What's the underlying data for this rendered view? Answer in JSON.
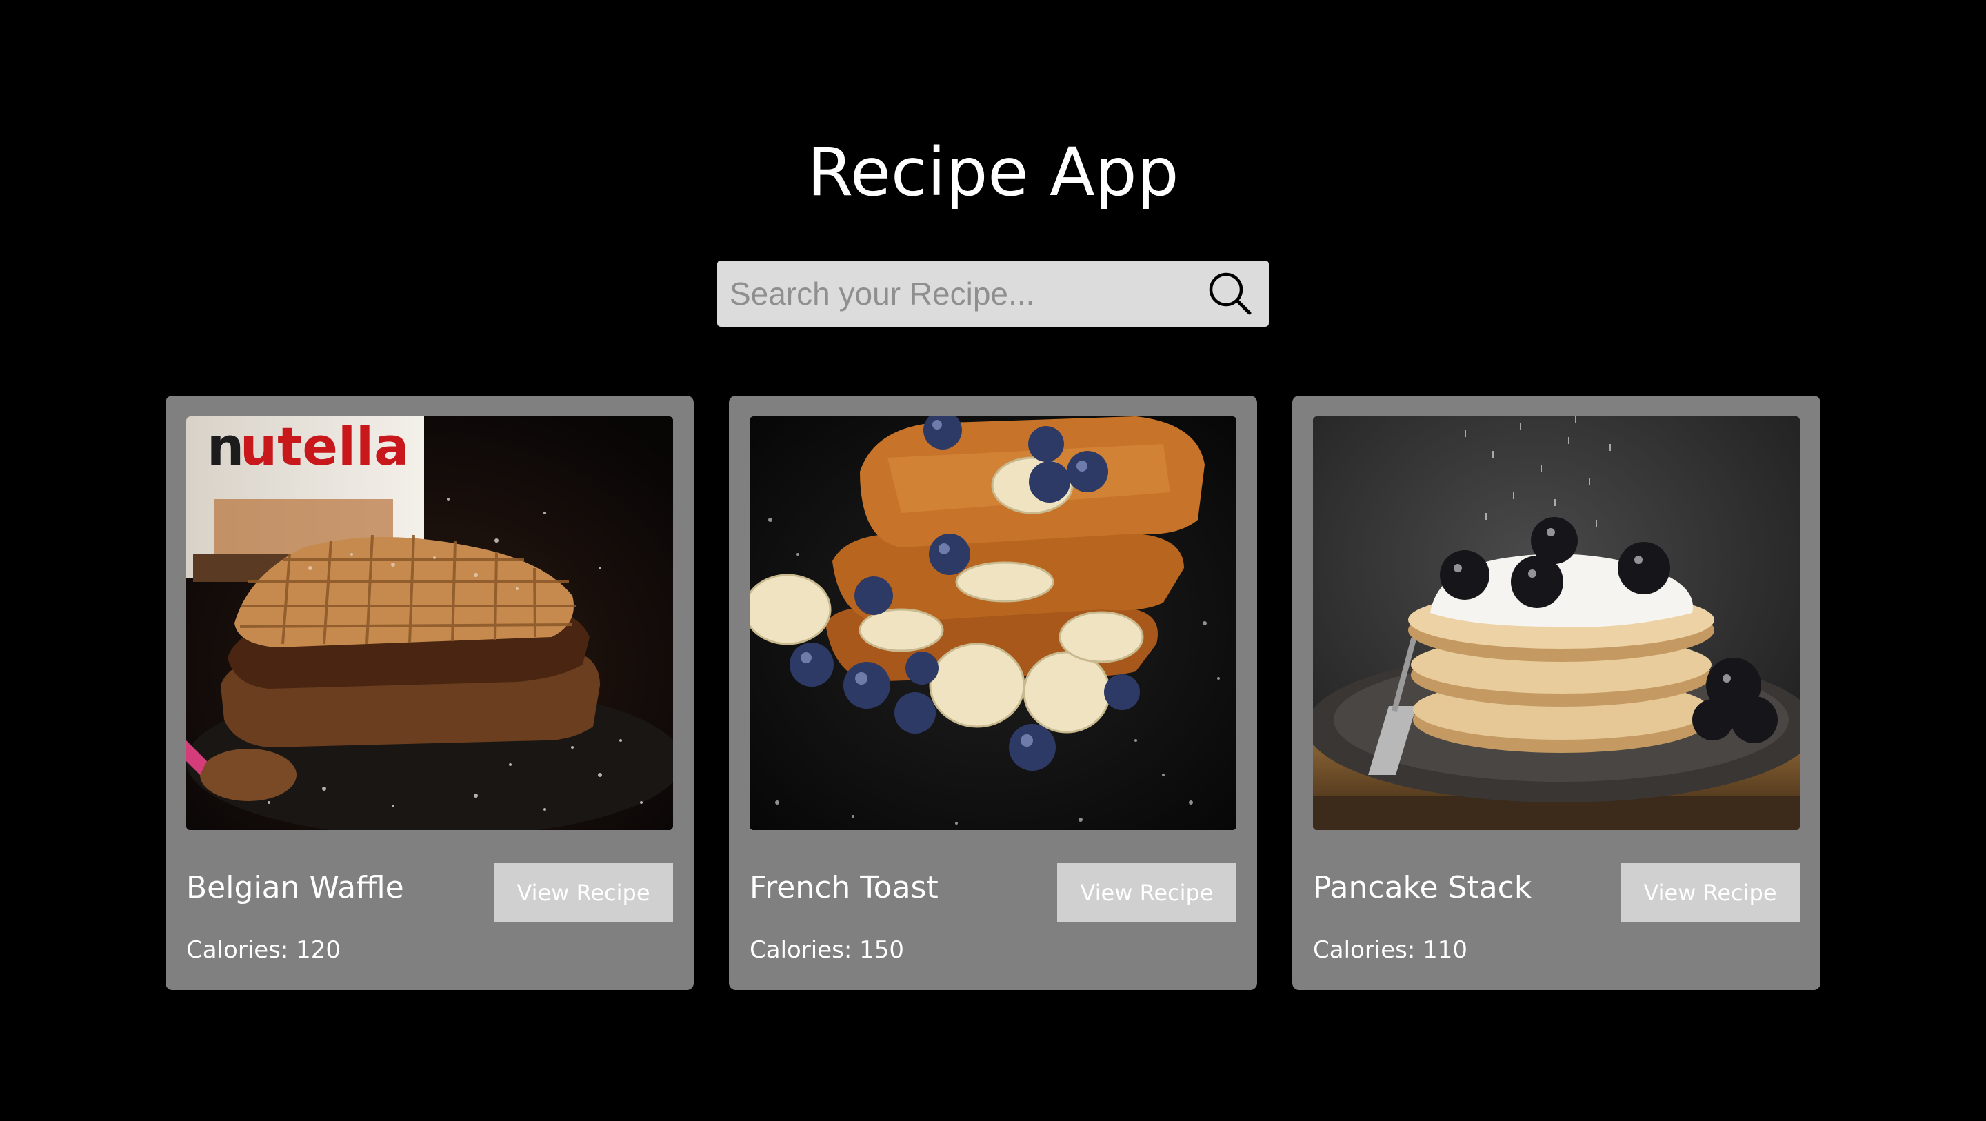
{
  "app": {
    "title": "Recipe App"
  },
  "search": {
    "placeholder": "Search your Recipe...",
    "value": "",
    "icon": "search-icon"
  },
  "recipes": [
    {
      "name": "Belgian Waffle",
      "calories_label": "Calories: 120",
      "button_label": "View Recipe",
      "image": "belgian-waffle-photo",
      "image_text": "nutella"
    },
    {
      "name": "French Toast",
      "calories_label": "Calories: 150",
      "button_label": "View Recipe",
      "image": "french-toast-photo"
    },
    {
      "name": "Pancake Stack",
      "calories_label": "Calories: 110",
      "button_label": "View Recipe",
      "image": "pancake-stack-photo"
    }
  ],
  "colors": {
    "background": "#000000",
    "card": "#808080",
    "button": "#d0d0d0",
    "search_bg": "#dcdcdc"
  }
}
